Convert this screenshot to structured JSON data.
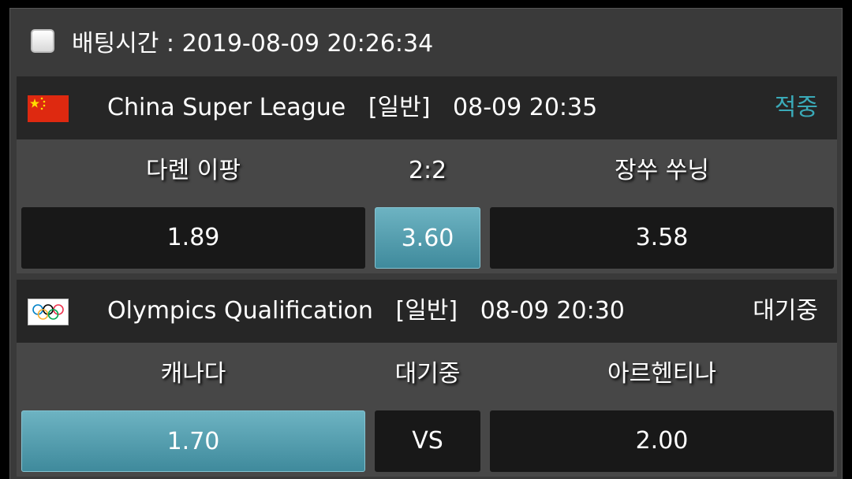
{
  "header": {
    "title": "배팅시간 : 2019-08-09 20:26:34"
  },
  "matches": [
    {
      "flag_icon": "china-flag-icon",
      "league": "China Super League",
      "type": "[일반]",
      "time": "08-09 20:35",
      "status": "적중",
      "status_color": "#3aaab8",
      "home": "다롄 이팡",
      "middle": "2:2",
      "away": "장쑤 쑤닝",
      "odds_home": "1.89",
      "odds_mid": "3.60",
      "odds_away": "3.58",
      "selected": "mid"
    },
    {
      "flag_icon": "olympic-rings-icon",
      "league": "Olympics Qualification",
      "type": "[일반]",
      "time": "08-09 20:30",
      "status": "대기중",
      "status_color": "#ffffff",
      "home": "캐나다",
      "middle": "대기중",
      "away": "아르헨티나",
      "odds_home": "1.70",
      "odds_mid": "VS",
      "odds_away": "2.00",
      "selected": "home"
    }
  ],
  "colors": {
    "selected_odds": "#4f9cae",
    "won": "#3aaab8"
  }
}
